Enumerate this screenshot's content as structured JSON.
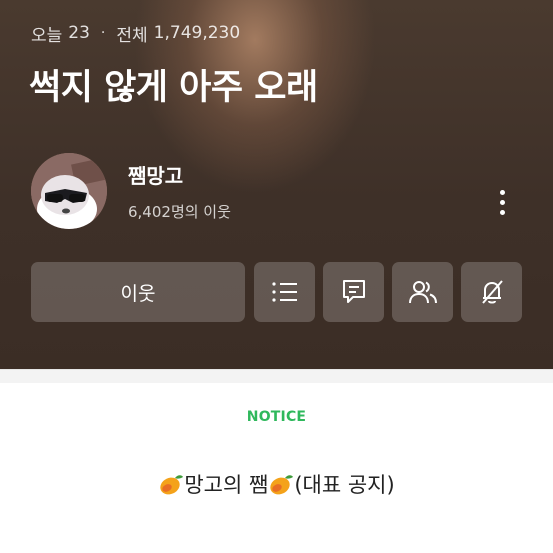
{
  "stats": {
    "today_label": "오늘",
    "today_count": "23",
    "separator": "·",
    "total_label": "전체",
    "total_count": "1,749,230"
  },
  "blog": {
    "title": "썩지 않게 아주 오래"
  },
  "profile": {
    "nickname": "쨈망고",
    "neighbor_count": "6,402명의 이웃"
  },
  "actions": {
    "follow_label": "이웃",
    "icons": [
      "list-icon",
      "guestbook-icon",
      "buddies-icon",
      "notification-off-icon"
    ]
  },
  "notice": {
    "label": "NOTICE",
    "title_text": "망고의 쨈",
    "title_suffix": "(대표 공지)",
    "emoji": "mango-emoji"
  },
  "colors": {
    "header_bg": "#3e3028",
    "notice_accent": "#2fb85c",
    "button_bg": "rgba(255,255,255,0.2)"
  }
}
